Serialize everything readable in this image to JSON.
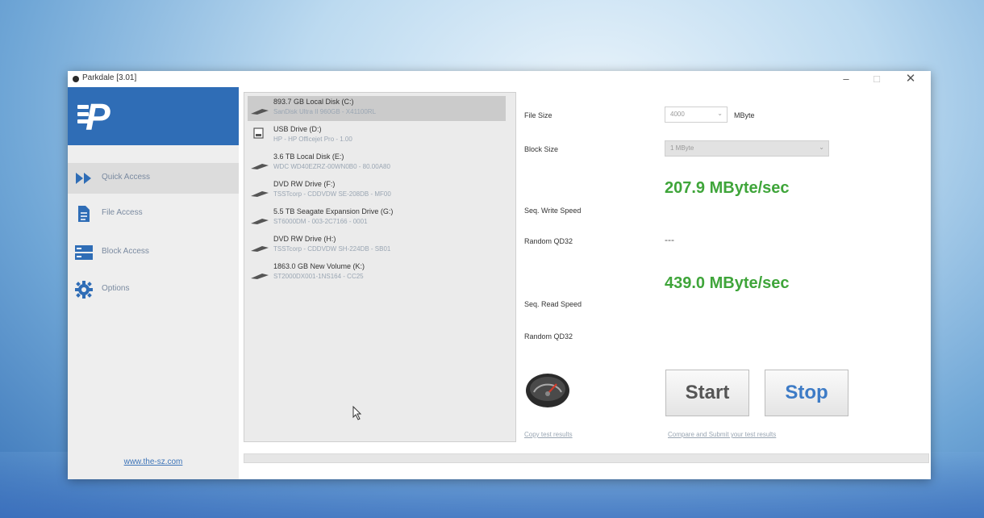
{
  "window": {
    "title": "Parkdale [3.01]",
    "minimize": "–",
    "maximize": "□",
    "close": "✕"
  },
  "sidebar": {
    "items": [
      {
        "label": "Quick Access",
        "icon": "fast-forward-icon",
        "active": true
      },
      {
        "label": "File Access",
        "icon": "file-icon",
        "active": false
      },
      {
        "label": "Block Access",
        "icon": "blocks-icon",
        "active": false
      },
      {
        "label": "Options",
        "icon": "gear-icon",
        "active": false
      }
    ],
    "website": "www.the-sz.com"
  },
  "drives": [
    {
      "name": "893.7 GB Local Disk (C:)",
      "detail": "SanDisk Ultra II 960GB - X41100RL",
      "icon": "hard-disk-icon",
      "selected": true
    },
    {
      "name": "USB Drive (D:)",
      "detail": "HP - HP Officejet Pro - 1.00",
      "icon": "usb-drive-icon",
      "selected": false
    },
    {
      "name": "3.6 TB Local Disk (E:)",
      "detail": "WDC WD40EZRZ-00WN0B0 - 80.00A80",
      "icon": "hard-disk-icon",
      "selected": false
    },
    {
      "name": "DVD RW Drive (F:)",
      "detail": "TSSTcorp - CDDVDW SE-208DB - MF00",
      "icon": "optical-drive-icon",
      "selected": false
    },
    {
      "name": "5.5 TB Seagate Expansion Drive (G:)",
      "detail": "ST6000DM - 003-2C7166 - 0001",
      "icon": "hard-disk-icon",
      "selected": false
    },
    {
      "name": "DVD RW Drive (H:)",
      "detail": "TSSTcorp - CDDVDW SH-224DB - SB01",
      "icon": "optical-drive-icon",
      "selected": false
    },
    {
      "name": "1863.0 GB New Volume (K:)",
      "detail": "ST2000DX001-1NS164 - CC25",
      "icon": "hard-disk-icon",
      "selected": false
    }
  ],
  "settings": {
    "file_size_label": "File Size",
    "file_size_value": "4000",
    "file_size_unit": "MByte",
    "block_size_label": "Block Size",
    "block_size_value": "1 MByte"
  },
  "results": {
    "seq_write_label": "Seq. Write Speed",
    "seq_write_value": "207.9 MByte/sec",
    "random_write_label": "Random QD32",
    "random_write_value": "---",
    "seq_read_label": "Seq. Read Speed",
    "seq_read_value": "439.0 MByte/sec",
    "random_read_label": "Random QD32"
  },
  "actions": {
    "copy_label": "Copy test results",
    "compare_label": "Compare and Submit your test results",
    "start_label": "Start",
    "stop_label": "Stop"
  },
  "progress": {
    "value": 0
  },
  "colors": {
    "accent": "#2f6db6",
    "speed": "#3fa53a",
    "stop": "#3d7bc6"
  }
}
